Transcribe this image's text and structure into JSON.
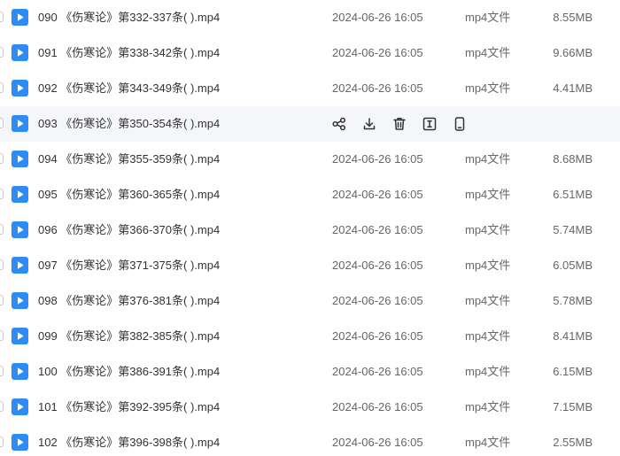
{
  "colors": {
    "accent": "#2f8cf5",
    "hover_row": "#f5f6fa",
    "text_primary": "#333333",
    "text_secondary": "#666666"
  },
  "icons": {
    "file": "video-file-icon",
    "actions": [
      "share-icon",
      "download-icon",
      "delete-icon",
      "rename-icon",
      "phone-icon"
    ]
  },
  "files": [
    {
      "name": "090 《伤寒论》第332-337条( ).mp4",
      "date": "2024-06-26 16:05",
      "type": "mp4文件",
      "size": "8.55MB"
    },
    {
      "name": "091 《伤寒论》第338-342条( ).mp4",
      "date": "2024-06-26 16:05",
      "type": "mp4文件",
      "size": "9.66MB"
    },
    {
      "name": "092 《伤寒论》第343-349条( ).mp4",
      "date": "2024-06-26 16:05",
      "type": "mp4文件",
      "size": "4.41MB"
    },
    {
      "name": "093 《伤寒论》第350-354条( ).mp4",
      "date": "",
      "type": "",
      "size": "",
      "hovered": true
    },
    {
      "name": "094 《伤寒论》第355-359条( ).mp4",
      "date": "2024-06-26 16:05",
      "type": "mp4文件",
      "size": "8.68MB"
    },
    {
      "name": "095 《伤寒论》第360-365条( ).mp4",
      "date": "2024-06-26 16:05",
      "type": "mp4文件",
      "size": "6.51MB"
    },
    {
      "name": "096 《伤寒论》第366-370条( ).mp4",
      "date": "2024-06-26 16:05",
      "type": "mp4文件",
      "size": "5.74MB"
    },
    {
      "name": "097 《伤寒论》第371-375条( ).mp4",
      "date": "2024-06-26 16:05",
      "type": "mp4文件",
      "size": "6.05MB"
    },
    {
      "name": "098 《伤寒论》第376-381条( ).mp4",
      "date": "2024-06-26 16:05",
      "type": "mp4文件",
      "size": "5.78MB"
    },
    {
      "name": "099 《伤寒论》第382-385条( ).mp4",
      "date": "2024-06-26 16:05",
      "type": "mp4文件",
      "size": "8.41MB"
    },
    {
      "name": "100 《伤寒论》第386-391条( ).mp4",
      "date": "2024-06-26 16:05",
      "type": "mp4文件",
      "size": "6.15MB"
    },
    {
      "name": "101 《伤寒论》第392-395条( ).mp4",
      "date": "2024-06-26 16:05",
      "type": "mp4文件",
      "size": "7.15MB"
    },
    {
      "name": "102 《伤寒论》第396-398条( ).mp4",
      "date": "2024-06-26 16:05",
      "type": "mp4文件",
      "size": "2.55MB"
    }
  ]
}
